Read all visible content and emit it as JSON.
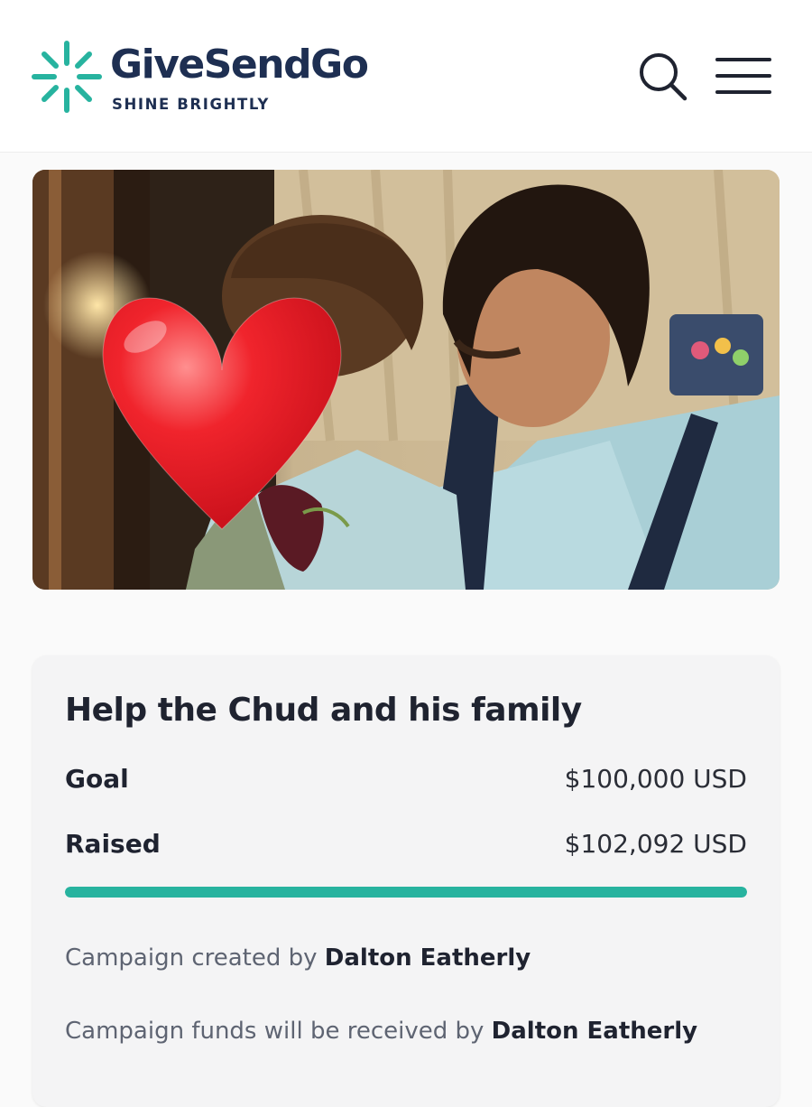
{
  "header": {
    "brand_name": "GiveSendGo",
    "tagline": "SHINE BRIGHTLY",
    "brand_color": "#1e2f52",
    "accent_color": "#27b39f",
    "icons": {
      "search": "search-icon",
      "menu": "hamburger-menu-icon"
    }
  },
  "campaign": {
    "title": "Help the Chud and his family",
    "goal_label": "Goal",
    "goal_value": "$100,000 USD",
    "raised_label": "Raised",
    "raised_value": "$102,092 USD",
    "progress_percent": 100,
    "creator_prefix": "Campaign created by",
    "creator_name": "Dalton Eatherly",
    "recipient_prefix": "Campaign funds will be received by",
    "recipient_name": "Dalton Eatherly"
  }
}
